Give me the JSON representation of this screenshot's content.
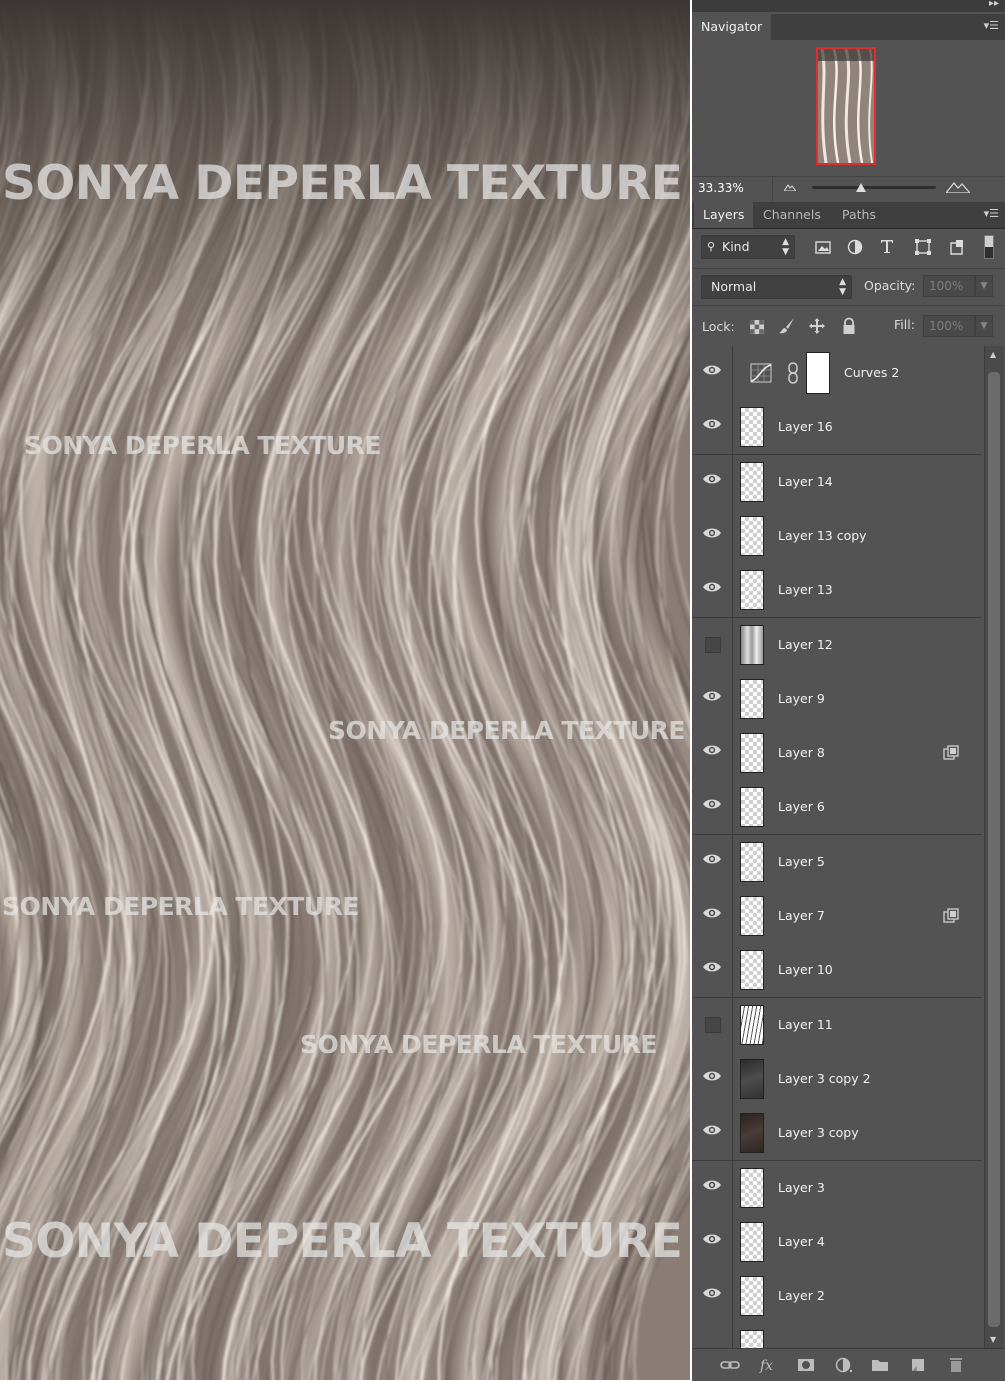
{
  "canvas": {
    "watermarks": [
      "SONYA DEPERLA TEXTURE",
      "SONYA DEPERLA TEXTURE",
      "SONYA DEPERLA TEXTURE",
      "SONYA DEPERLA TEXTURE",
      "SONYA DEPERLA TEXTURE",
      "SONYA DEPERLA TEXTURE"
    ]
  },
  "navigator": {
    "tab": "Navigator",
    "zoom": "33.33%"
  },
  "layers_panel": {
    "tabs": [
      "Layers",
      "Channels",
      "Paths"
    ],
    "filter_label": "Kind",
    "blend_mode": "Normal",
    "opacity_label": "Opacity:",
    "opacity_value": "100%",
    "lock_label": "Lock:",
    "fill_label": "Fill:",
    "fill_value": "100%",
    "layers": [
      {
        "name": "Curves 2",
        "visible": true,
        "thumb": "adjustment"
      },
      {
        "name": "Layer 16",
        "visible": true,
        "thumb": "transparent"
      },
      {
        "name": "Layer 14",
        "visible": true,
        "thumb": "transparent"
      },
      {
        "name": "Layer 13 copy",
        "visible": true,
        "thumb": "transparent"
      },
      {
        "name": "Layer 13",
        "visible": true,
        "thumb": "transparent"
      },
      {
        "name": "Layer 12",
        "visible": false,
        "thumb": "hair"
      },
      {
        "name": "Layer 9",
        "visible": true,
        "thumb": "transparent"
      },
      {
        "name": "Layer 8",
        "visible": true,
        "thumb": "transparent",
        "smart": true
      },
      {
        "name": "Layer 6",
        "visible": true,
        "thumb": "transparent"
      },
      {
        "name": "Layer 5",
        "visible": true,
        "thumb": "transparent"
      },
      {
        "name": "Layer 7",
        "visible": true,
        "thumb": "transparent",
        "smart": true
      },
      {
        "name": "Layer 10",
        "visible": true,
        "thumb": "transparent"
      },
      {
        "name": "Layer 11",
        "visible": false,
        "thumb": "hair2"
      },
      {
        "name": "Layer 3 copy 2",
        "visible": true,
        "thumb": "dark"
      },
      {
        "name": "Layer 3 copy",
        "visible": true,
        "thumb": "dark2"
      },
      {
        "name": "Layer 3",
        "visible": true,
        "thumb": "transparent"
      },
      {
        "name": "Layer 4",
        "visible": true,
        "thumb": "transparent"
      },
      {
        "name": "Layer 2",
        "visible": true,
        "thumb": "transparent"
      }
    ]
  },
  "colors": {
    "panel_bg": "#535353",
    "tab_bar": "#3f3f3f",
    "navigator_frame": "#e02d2d",
    "hair_base": "#8a7d75",
    "hair_highlight": "#f4ede4"
  }
}
